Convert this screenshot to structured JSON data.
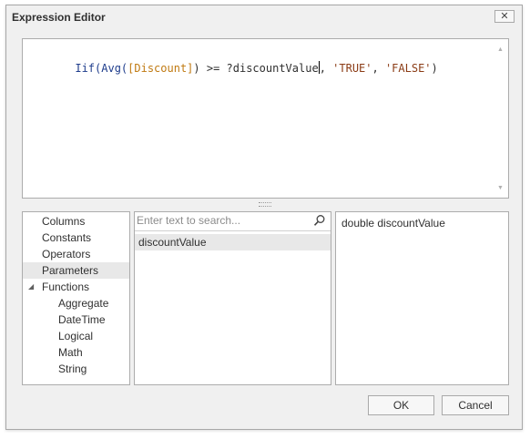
{
  "window": {
    "title": "Expression Editor",
    "close_glyph": "✕"
  },
  "editor": {
    "tokens": [
      {
        "text": "Iif(Avg(",
        "kind": "function"
      },
      {
        "text": "[Discount]",
        "kind": "field"
      },
      {
        "text": ") >= ?discountValue",
        "kind": "parameter"
      },
      {
        "text": ", ",
        "kind": "parameter"
      },
      {
        "text": "'TRUE'",
        "kind": "string"
      },
      {
        "text": ", ",
        "kind": "parameter"
      },
      {
        "text": "'FALSE'",
        "kind": "string"
      },
      {
        "text": ")",
        "kind": "parameter"
      }
    ],
    "scroll_up_glyph": "▲",
    "scroll_down_glyph": "▼"
  },
  "categories": {
    "items": [
      {
        "label": "Columns"
      },
      {
        "label": "Constants"
      },
      {
        "label": "Operators"
      },
      {
        "label": "Parameters",
        "selected": true
      },
      {
        "label": "Functions",
        "expanded": true
      },
      {
        "label": "Aggregate",
        "sub": true
      },
      {
        "label": "DateTime",
        "sub": true
      },
      {
        "label": "Logical",
        "sub": true
      },
      {
        "label": "Math",
        "sub": true
      },
      {
        "label": "String",
        "sub": true
      }
    ],
    "expand_glyph": "◢"
  },
  "search": {
    "placeholder": "Enter text to search...",
    "value": ""
  },
  "items_list": [
    "discountValue"
  ],
  "description": "double discountValue",
  "buttons": {
    "ok": "OK",
    "cancel": "Cancel"
  },
  "colors": {
    "function": "#1f3d8c",
    "field": "#c07a12",
    "string": "#8b3c16",
    "selection": "#e8e8e8"
  }
}
